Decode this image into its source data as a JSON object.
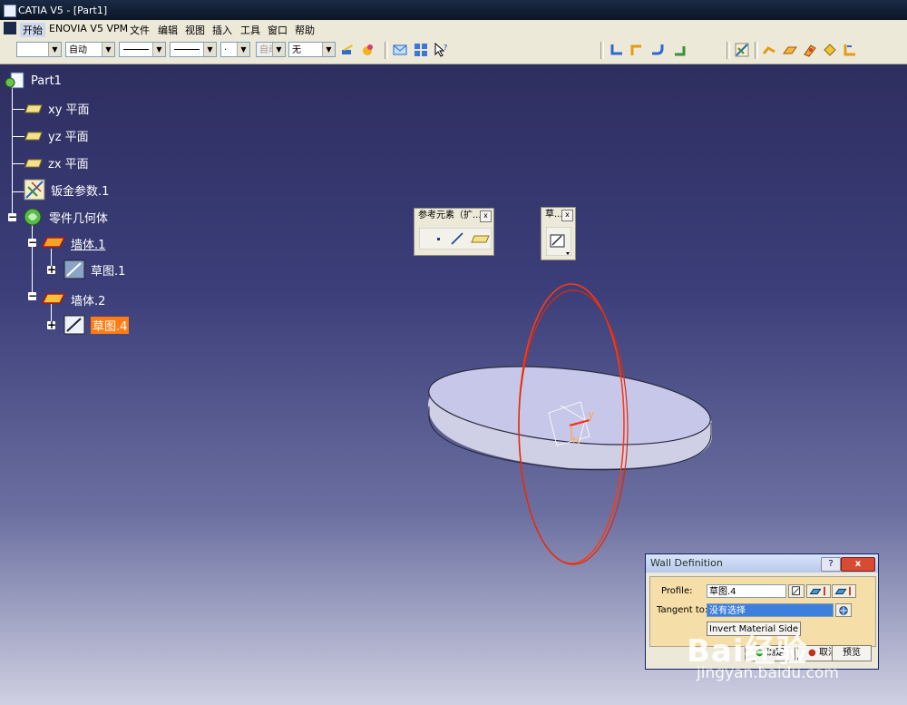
{
  "window": {
    "title": "CATIA V5 - [Part1]"
  },
  "menu": [
    "开始",
    "ENOVIA V5 VPM",
    "文件",
    "编辑",
    "视图",
    "插入",
    "工具",
    "窗口",
    "帮助"
  ],
  "toolbar": {
    "color_value": "",
    "transparency_value": "自动",
    "linetype_value": "",
    "thickness_value": "",
    "point_value": "·",
    "layer_value": "自动",
    "filter_value": "无"
  },
  "tree": {
    "root": "Part1",
    "xy": "xy 平面",
    "yz": "yz 平面",
    "zx": "zx 平面",
    "sheet_params": "钣金参数.1",
    "body": "零件几何体",
    "wall1": "墙体.1",
    "sketch1": "草图.1",
    "wall2": "墙体.2",
    "sketch4": "草图.4"
  },
  "panels": {
    "ref_title": "参考元素（扩...",
    "sketch_title": "草...",
    "close": "x"
  },
  "dialog": {
    "title": "Wall Definition",
    "help": "?",
    "close": "x",
    "profile_label": "Profile:",
    "profile_value": "草图.4",
    "tangent_label": "Tangent to:",
    "tangent_value": "没有选择",
    "invert_button": "Invert Material Side",
    "ok_button": "确定",
    "cancel_button": "取消",
    "preview_button": "预览"
  },
  "axes": {
    "y": "y",
    "h": "H"
  },
  "watermark": {
    "logo": "Bai经验",
    "url": "jingyan.baidu.com"
  }
}
